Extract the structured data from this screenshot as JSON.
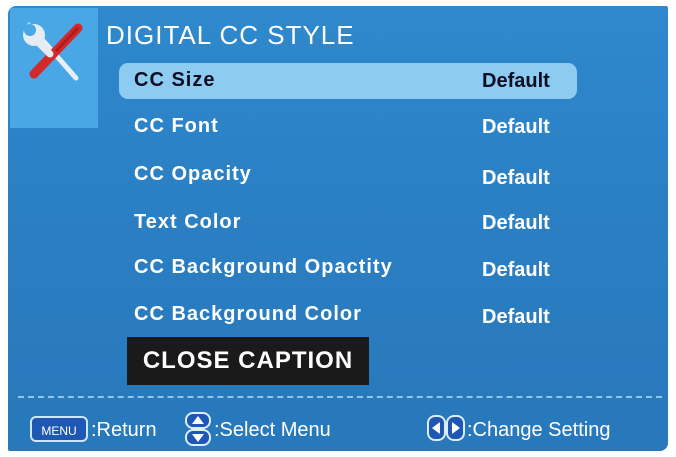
{
  "title": "DIGITAL CC STYLE",
  "icon": "tools-icon",
  "menu_items": [
    {
      "label": "CC Size",
      "value": "Default",
      "selected": true
    },
    {
      "label": "CC Font",
      "value": "Default"
    },
    {
      "label": "CC Opacity",
      "value": "Default"
    },
    {
      "label": "Text Color",
      "value": "Default"
    },
    {
      "label": "CC Background Opactity",
      "value": "Default"
    },
    {
      "label": "CC Background Color",
      "value": "Default"
    }
  ],
  "close_caption_label": "CLOSE CAPTION",
  "footer": {
    "menu_key": "MENU",
    "return_text": ":Return",
    "select_text": ":Select Menu",
    "change_text": ":Change Setting"
  },
  "colors": {
    "background": "#2b7fc3",
    "selected_row": "#8ecbf0",
    "close_caption_bg": "#1a1a1a"
  }
}
